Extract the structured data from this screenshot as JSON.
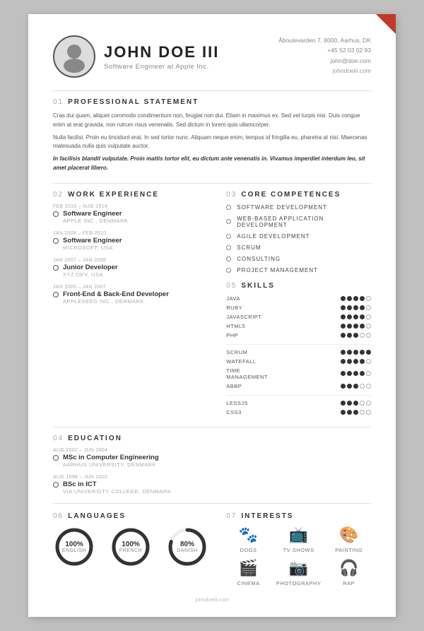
{
  "header": {
    "name": "JOHN DOE III",
    "subtitle": "Software Engineer at Apple Inc.",
    "address": "Åboulevarden 7, 8000, Aarhus, DK",
    "phone": "+45 52 03 02 93",
    "email": "john@doe.com",
    "website": "johndoeiii.com"
  },
  "sections": {
    "professional_statement": {
      "number": "01",
      "title": "PROFESSIONAL STATEMENT",
      "paragraphs": [
        "Cras dui quam, aliquet commodo condimentum non, feugiat non dui. Etiam in maximus ex. Sed vel turpis nisi. Duis congue enim at erat gravida, non rutrum risus venenatis. Sed dictum in lorem quis ullamcorper.",
        "Nulla facilisi. Proin eu tincidunt erat. In sed tortor nunc. Aliquam neque enim, tempus id fringilla eu, pharetra at nisi. Maecenas malesuada nulla quis vulputate auctor.",
        "In facilisis blandit vulputate. Proin mattis tortor elit, eu dictum ante venenatis in. Vivamus imperdiet interdum leo, sit amet placerat libero."
      ]
    },
    "work_experience": {
      "number": "02",
      "title": "WORK EXPERIENCE",
      "items": [
        {
          "date": "FEB 2010 – AUG 2014",
          "title": "Software Engineer",
          "company": "APPLE INC., DENMARK"
        },
        {
          "date": "JAN 2008 – FEB 2010",
          "title": "Software Engineer",
          "company": "MICROSOFT, USA"
        },
        {
          "date": "JAN 2007 – JAN 2008",
          "title": "Junior Developer",
          "company": "XYZ DEV, USA"
        },
        {
          "date": "JAN 2005 – JAN 2007",
          "title": "Front-End & Back-End Developer",
          "company": "APPLESEED INC., DENMARK"
        }
      ]
    },
    "education": {
      "number": "04",
      "title": "EDUCATION",
      "items": [
        {
          "date": "AUG 2002 – JUN 2004",
          "title": "MSc in Computer Engineering",
          "company": "AARHUS UNIVERSITY, DENMARK"
        },
        {
          "date": "AUG 1998 – JUN 2002",
          "title": "BSc in ICT",
          "company": "VIA UNIVERSITY COLLEGE, DENMARK"
        }
      ]
    },
    "core_competences": {
      "number": "03",
      "title": "CORE COMPETENCES",
      "items": [
        "SOFTWARE DEVELOPMENT",
        "WEB-BASED APPLICATION DEVELOPMENT",
        "AGILE DEVELOPMENT",
        "SCRUM",
        "CONSULTING",
        "PROJECT MANAGEMENT"
      ]
    },
    "skills": {
      "number": "05",
      "title": "SKILLS",
      "groups": [
        {
          "items": [
            {
              "name": "JAVA",
              "filled": 4,
              "empty": 1
            },
            {
              "name": "RUBY",
              "filled": 4,
              "empty": 1
            },
            {
              "name": "JAVASCRIPT",
              "filled": 4,
              "empty": 1
            },
            {
              "name": "HTML5",
              "filled": 4,
              "empty": 1
            },
            {
              "name": "PHP",
              "filled": 3,
              "empty": 2
            }
          ]
        },
        {
          "items": [
            {
              "name": "SCRUM",
              "filled": 5,
              "empty": 0
            },
            {
              "name": "WATEFALL",
              "filled": 4,
              "empty": 1
            },
            {
              "name": "TIME MANAGEMENT",
              "filled": 4,
              "empty": 1
            },
            {
              "name": "ABBP",
              "filled": 3,
              "empty": 2
            }
          ]
        },
        {
          "items": [
            {
              "name": "LESSJS",
              "filled": 3,
              "empty": 2
            },
            {
              "name": "CSS3",
              "filled": 3,
              "empty": 2
            }
          ]
        }
      ]
    },
    "languages": {
      "number": "06",
      "title": "LANGUAGES",
      "items": [
        {
          "name": "ENGLISH",
          "percent": 100
        },
        {
          "name": "FRENCH",
          "percent": 100
        },
        {
          "name": "DANISH",
          "percent": 80
        }
      ]
    },
    "interests": {
      "number": "07",
      "title": "INTERESTS",
      "items": [
        {
          "icon": "🐾",
          "label": "DOGS"
        },
        {
          "icon": "📺",
          "label": "TV SHOWS"
        },
        {
          "icon": "🎨",
          "label": "PAINTING"
        },
        {
          "icon": "🎬",
          "label": "CINEMA"
        },
        {
          "icon": "📷",
          "label": "PHOTOGRAPHY"
        },
        {
          "icon": "🎧",
          "label": "RAP"
        }
      ]
    }
  },
  "footer": {
    "website": "johndoeiii.com"
  }
}
